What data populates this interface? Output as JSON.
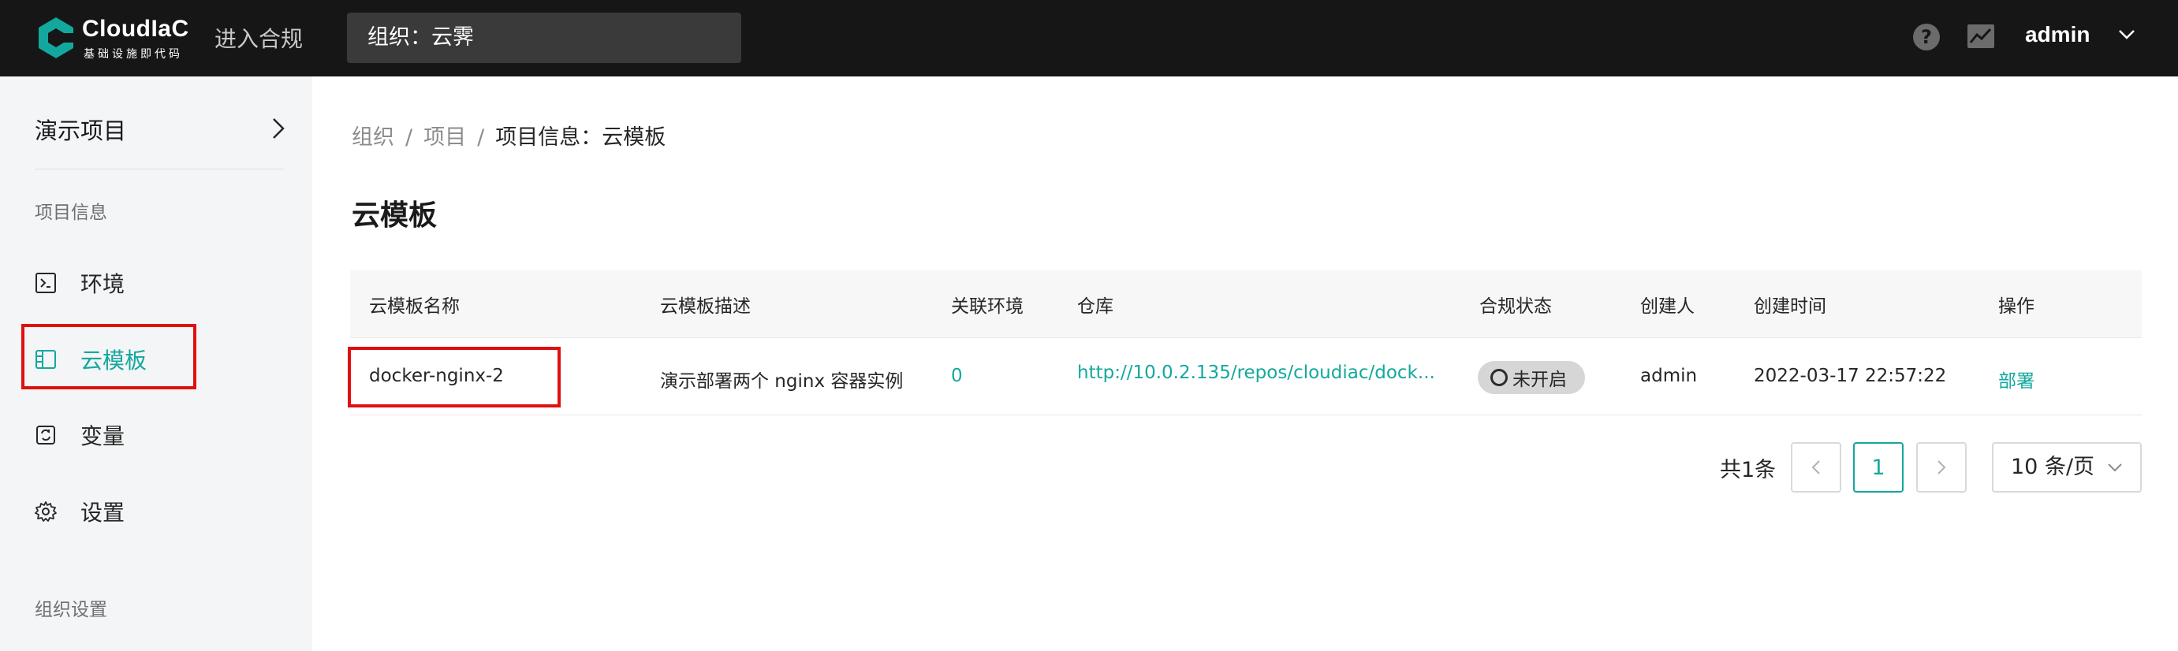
{
  "header": {
    "brand_name": "CloudIaC",
    "brand_sub": "基础设施即代码",
    "compliance_label": "进入合规",
    "org_selector": "组织：云霁",
    "help_glyph": "?",
    "user": "admin"
  },
  "sidebar": {
    "project_name": "演示项目",
    "section_project": "项目信息",
    "items": [
      {
        "label": "环境",
        "icon": "terminal-icon"
      },
      {
        "label": "云模板",
        "icon": "template-icon",
        "active": true
      },
      {
        "label": "变量",
        "icon": "variable-icon"
      },
      {
        "label": "设置",
        "icon": "gear-icon"
      }
    ],
    "section_org": "组织设置"
  },
  "breadcrumb": {
    "items": [
      "组织",
      "项目",
      "项目信息：云模板"
    ],
    "separator": "/"
  },
  "page_title": "云模板",
  "table": {
    "columns": [
      "云模板名称",
      "云模板描述",
      "关联环境",
      "仓库",
      "合规状态",
      "创建人",
      "创建时间",
      "操作"
    ],
    "rows": [
      {
        "name": "docker-nginx-2",
        "description": "演示部署两个 nginx 容器实例",
        "env_count": "0",
        "repo": "http://10.0.2.135/repos/cloudiac/dock...",
        "compliance": "未开启",
        "creator": "admin",
        "created_at": "2022-03-17 22:57:22",
        "action": "部署"
      }
    ]
  },
  "pagination": {
    "total": "共1条",
    "current_page": "1",
    "page_size": "10 条/页"
  },
  "colors": {
    "accent": "#13a89e",
    "topbar": "#161616",
    "sidebar": "#f4f5f6",
    "highlight": "#e01010"
  }
}
